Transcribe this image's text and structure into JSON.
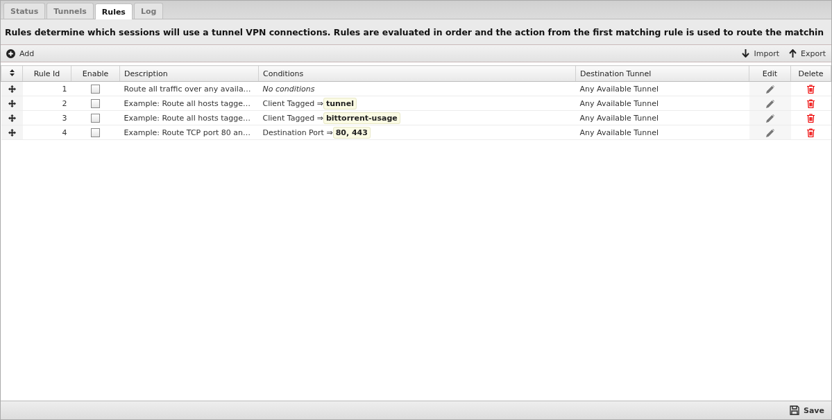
{
  "tabs": [
    {
      "label": "Status",
      "selected": false
    },
    {
      "label": "Tunnels",
      "selected": false
    },
    {
      "label": "Rules",
      "selected": true
    },
    {
      "label": "Log",
      "selected": false
    }
  ],
  "banner": "Rules determine which sessions will use a tunnel VPN connections. Rules are evaluated in order and the action from the first matching rule is used to route the matchin",
  "toolbar": {
    "add": "Add",
    "import": "Import",
    "export": "Export"
  },
  "table": {
    "columns": [
      "Rule Id",
      "Enable",
      "Description",
      "Conditions",
      "Destination Tunnel",
      "Edit",
      "Delete"
    ],
    "rows": [
      {
        "rule_id": "1",
        "enabled": false,
        "description": "Route all traffic over any availa…",
        "condition": {
          "kind": "none",
          "text": "No conditions"
        },
        "destination": "Any Available Tunnel"
      },
      {
        "rule_id": "2",
        "enabled": false,
        "description": "Example: Route all hosts tagge…",
        "condition": {
          "kind": "match",
          "text": "Client Tagged ⇒",
          "value": "tunnel"
        },
        "destination": "Any Available Tunnel"
      },
      {
        "rule_id": "3",
        "enabled": false,
        "description": "Example: Route all hosts tagge…",
        "condition": {
          "kind": "match",
          "text": "Client Tagged ⇒",
          "value": "bittorrent-usage"
        },
        "destination": "Any Available Tunnel"
      },
      {
        "rule_id": "4",
        "enabled": false,
        "description": "Example: Route TCP port 80 an…",
        "condition": {
          "kind": "match",
          "text": "Destination Port ⇒",
          "value": "80, 443"
        },
        "destination": "Any Available Tunnel"
      }
    ]
  },
  "footer": {
    "save": "Save"
  }
}
